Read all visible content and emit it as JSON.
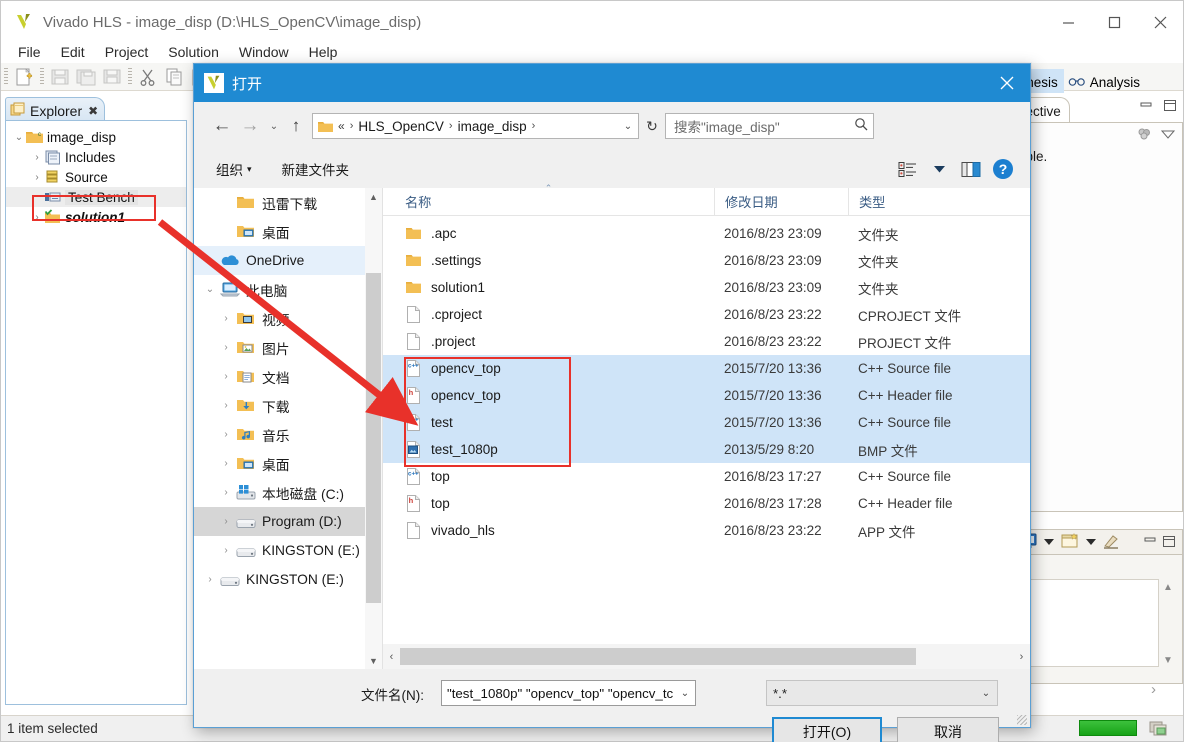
{
  "ide": {
    "title": "Vivado HLS - image_disp (D:\\HLS_OpenCV\\image_disp)",
    "menu": [
      "File",
      "Edit",
      "Project",
      "Solution",
      "Window",
      "Help"
    ],
    "window_controls": {
      "minimize": "—",
      "maximize": "☐",
      "close": "✕"
    },
    "explorer": {
      "tab_label": "Explorer",
      "tab_close": "✖",
      "tree": [
        {
          "label": "image_disp",
          "twisty": "⌄",
          "icon": "project-folder-icon",
          "indent": 0,
          "bold": false,
          "highlight": false
        },
        {
          "label": "Includes",
          "twisty": "›",
          "icon": "includes-icon",
          "indent": 1,
          "bold": false,
          "highlight": false
        },
        {
          "label": "Source",
          "twisty": "›",
          "icon": "source-folder-icon",
          "indent": 1,
          "bold": false,
          "highlight": false
        },
        {
          "label": "Test Bench",
          "twisty": "",
          "icon": "testbench-icon",
          "indent": 1,
          "bold": false,
          "highlight": true
        },
        {
          "label": "solution1",
          "twisty": "›",
          "icon": "solution-folder-icon",
          "indent": 1,
          "bold": true,
          "highlight": false
        }
      ]
    },
    "right_panel": {
      "tab_synthesis": "nthesis",
      "tab_analysis": "Analysis",
      "tab_directive": "irective",
      "body_text": "lable."
    },
    "status_bar": {
      "text": "1 item selected"
    }
  },
  "dialog": {
    "title": "打开",
    "close": "✕",
    "nav": {
      "back": "←",
      "forward": "→",
      "history": "⌄",
      "up": "↑",
      "breadcrumb": {
        "prefix": "«",
        "parts": [
          "HLS_OpenCV",
          "image_disp"
        ],
        "sep": "›",
        "dropdown": "⌄"
      },
      "refresh": "↻",
      "search_placeholder": "搜索\"image_disp\"",
      "search_icon": "🔍"
    },
    "commandbar": {
      "organize": "组织",
      "organize_caret": "▾",
      "new_folder": "新建文件夹",
      "view_caret": "▾",
      "help": "?"
    },
    "places": [
      {
        "label": "迅雷下载",
        "expander": "",
        "icon": "folder-icon",
        "indent": 1,
        "state": "none"
      },
      {
        "label": "桌面",
        "expander": "",
        "icon": "desktop-folder-icon",
        "indent": 1,
        "state": "none"
      },
      {
        "label": "OneDrive",
        "expander": "›",
        "icon": "onedrive-icon",
        "indent": 0,
        "state": "light"
      },
      {
        "label": "此电脑",
        "expander": "⌄",
        "icon": "this-pc-icon",
        "indent": 0,
        "state": "none"
      },
      {
        "label": "视频",
        "expander": "›",
        "icon": "videos-icon",
        "indent": 1,
        "state": "none"
      },
      {
        "label": "图片",
        "expander": "›",
        "icon": "pictures-icon",
        "indent": 1,
        "state": "none"
      },
      {
        "label": "文档",
        "expander": "›",
        "icon": "documents-icon",
        "indent": 1,
        "state": "none"
      },
      {
        "label": "下载",
        "expander": "›",
        "icon": "downloads-icon",
        "indent": 1,
        "state": "none"
      },
      {
        "label": "音乐",
        "expander": "›",
        "icon": "music-icon",
        "indent": 1,
        "state": "none"
      },
      {
        "label": "桌面",
        "expander": "›",
        "icon": "desktop-folder-icon",
        "indent": 1,
        "state": "none"
      },
      {
        "label": "本地磁盘 (C:)",
        "expander": "›",
        "icon": "windows-drive-icon",
        "indent": 1,
        "state": "none"
      },
      {
        "label": "Program (D:)",
        "expander": "›",
        "icon": "drive-icon",
        "indent": 1,
        "state": "gray"
      },
      {
        "label": "KINGSTON (E:)",
        "expander": "›",
        "icon": "drive-icon",
        "indent": 1,
        "state": "none"
      },
      {
        "label": "KINGSTON (E:)",
        "expander": "›",
        "icon": "drive-icon",
        "indent": 0,
        "state": "none"
      }
    ],
    "filelist": {
      "columns": [
        "名称",
        "修改日期",
        "类型"
      ],
      "sort_indicator": "⌃",
      "rows": [
        {
          "name": ".apc",
          "date": "2016/8/23 23:09",
          "type": "文件夹",
          "icon": "folder-icon",
          "selected": false
        },
        {
          "name": ".settings",
          "date": "2016/8/23 23:09",
          "type": "文件夹",
          "icon": "folder-icon",
          "selected": false
        },
        {
          "name": "solution1",
          "date": "2016/8/23 23:09",
          "type": "文件夹",
          "icon": "folder-icon",
          "selected": false
        },
        {
          "name": ".cproject",
          "date": "2016/8/23 23:22",
          "type": "CPROJECT 文件",
          "icon": "generic-file-icon",
          "selected": false
        },
        {
          "name": ".project",
          "date": "2016/8/23 23:22",
          "type": "PROJECT 文件",
          "icon": "generic-file-icon",
          "selected": false
        },
        {
          "name": "opencv_top",
          "date": "2015/7/20 13:36",
          "type": "C++ Source file",
          "icon": "cpp-source-icon",
          "selected": true
        },
        {
          "name": "opencv_top",
          "date": "2015/7/20 13:36",
          "type": "C++ Header file",
          "icon": "h-header-icon",
          "selected": true
        },
        {
          "name": "test",
          "date": "2015/7/20 13:36",
          "type": "C++ Source file",
          "icon": "cpp-source-icon",
          "selected": true
        },
        {
          "name": "test_1080p",
          "date": "2013/5/29 8:20",
          "type": "BMP 文件",
          "icon": "bmp-image-icon",
          "selected": true
        },
        {
          "name": "top",
          "date": "2016/8/23 17:27",
          "type": "C++ Source file",
          "icon": "cpp-source-icon",
          "selected": false
        },
        {
          "name": "top",
          "date": "2016/8/23 17:28",
          "type": "C++ Header file",
          "icon": "h-header-icon",
          "selected": false
        },
        {
          "name": "vivado_hls",
          "date": "2016/8/23 23:22",
          "type": "APP 文件",
          "icon": "generic-file-icon",
          "selected": false
        }
      ],
      "hscroll": {
        "left": "‹",
        "right": "›"
      }
    },
    "footer": {
      "filename_label": "文件名(N):",
      "filename_value": "\"test_1080p\" \"opencv_top\" \"opencv_tc",
      "filename_caret": "⌄",
      "filter_value": "*.*",
      "filter_caret": "⌄",
      "open_button": "打开(O)",
      "cancel_button": "取消"
    }
  },
  "annotations": {
    "accent_red": "#e8312a",
    "accent_blue": "#1f8ad2",
    "selection_blue": "#cfe4f8"
  }
}
